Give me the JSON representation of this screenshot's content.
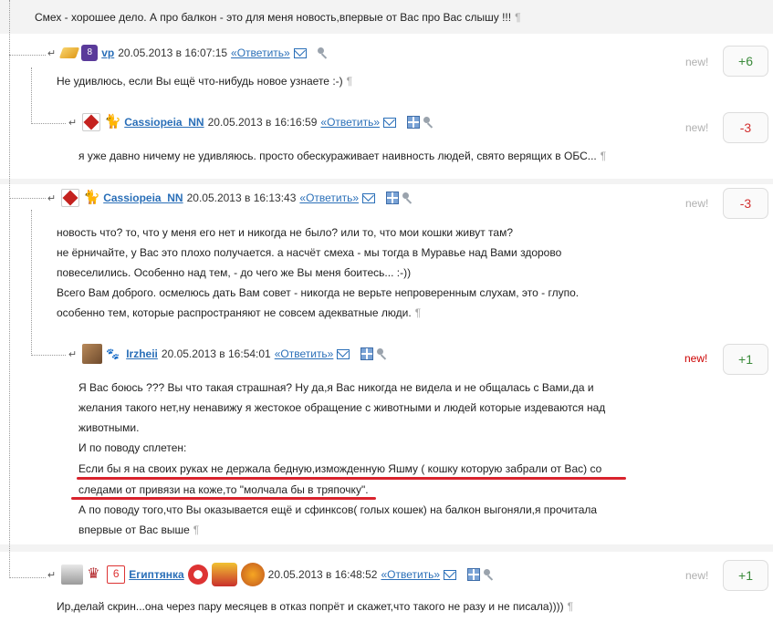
{
  "top_text": "Смех - хорошее дело. А про балкон - это для меня новость,впервые от Вас про Вас слышу !!!",
  "pilcrow": "¶",
  "comments": [
    {
      "user": "vp",
      "date": "20.05.2013 в 16:07:15",
      "reply": "«Ответить»",
      "new_label": "new!",
      "new_color": "#b0b0b0",
      "rating": "+6",
      "lines": [
        "Не удивлюсь, если Вы ещё что-нибудь новое узнаете :-)"
      ]
    },
    {
      "user": "Cassiopeia_NN",
      "date": "20.05.2013 в 16:16:59",
      "reply": "«Ответить»",
      "new_label": "new!",
      "new_color": "#b0b0b0",
      "rating": "-3",
      "lines": [
        "я уже давно ничему не удивляюсь. просто обескураживает наивность людей, свято верящих в ОБС..."
      ]
    },
    {
      "user": "Cassiopeia_NN",
      "date": "20.05.2013 в 16:13:43",
      "reply": "«Ответить»",
      "new_label": "new!",
      "new_color": "#b0b0b0",
      "rating": "-3",
      "lines": [
        "новость что? то, что у меня его нет и никогда не было? или то, что мои кошки живут там?",
        "не ёрничайте, у Вас это плохо получается. а насчёт смеха - мы тогда в Муравье над Вами здорово",
        "повеселились. Особенно над тем, - до чего же Вы меня боитесь... :-))",
        "Всего Вам доброго. осмелюсь дать Вам совет - никогда не верьте непроверенным слухам, это - глупо.",
        "особенно тем, которые распространяют не совсем адекватные люди."
      ]
    },
    {
      "user": "Irzheii",
      "date": "20.05.2013 в 16:54:01",
      "reply": "«Ответить»",
      "new_label": "new!",
      "new_color": "#cc0000",
      "rating": "+1",
      "lines": [
        "Я Вас боюсь ??? Вы что такая страшная? Ну да,я Вас никогда не видела и не общалась с Вами,да и",
        "желания такого нет,ну ненавижу я жестокое обращение с животными и людей которые издеваются над",
        "животными.",
        "И по поводу сплетен:",
        "Если бы я на своих руках не держала бедную,изможденную Яшму ( кошку которую забрали от Вас) со",
        "следами от привязи на коже,то \"молчала бы в тряпочку\".",
        "А по поводу того,что Вы оказывается ещё и сфинксов( голых кошек) на балкон выгоняли,я прочитала",
        "впервые от Вас выше"
      ]
    },
    {
      "user": "Египтянка",
      "date": "20.05.2013 в 16:48:52",
      "reply": "«Ответить»",
      "new_label": "new!",
      "new_color": "#b0b0b0",
      "rating": "+1",
      "lines": [
        "Ир,делай скрин...она через пару месяцев в отказ попрёт и скажет,что такого не разу и не писала))))"
      ]
    }
  ]
}
